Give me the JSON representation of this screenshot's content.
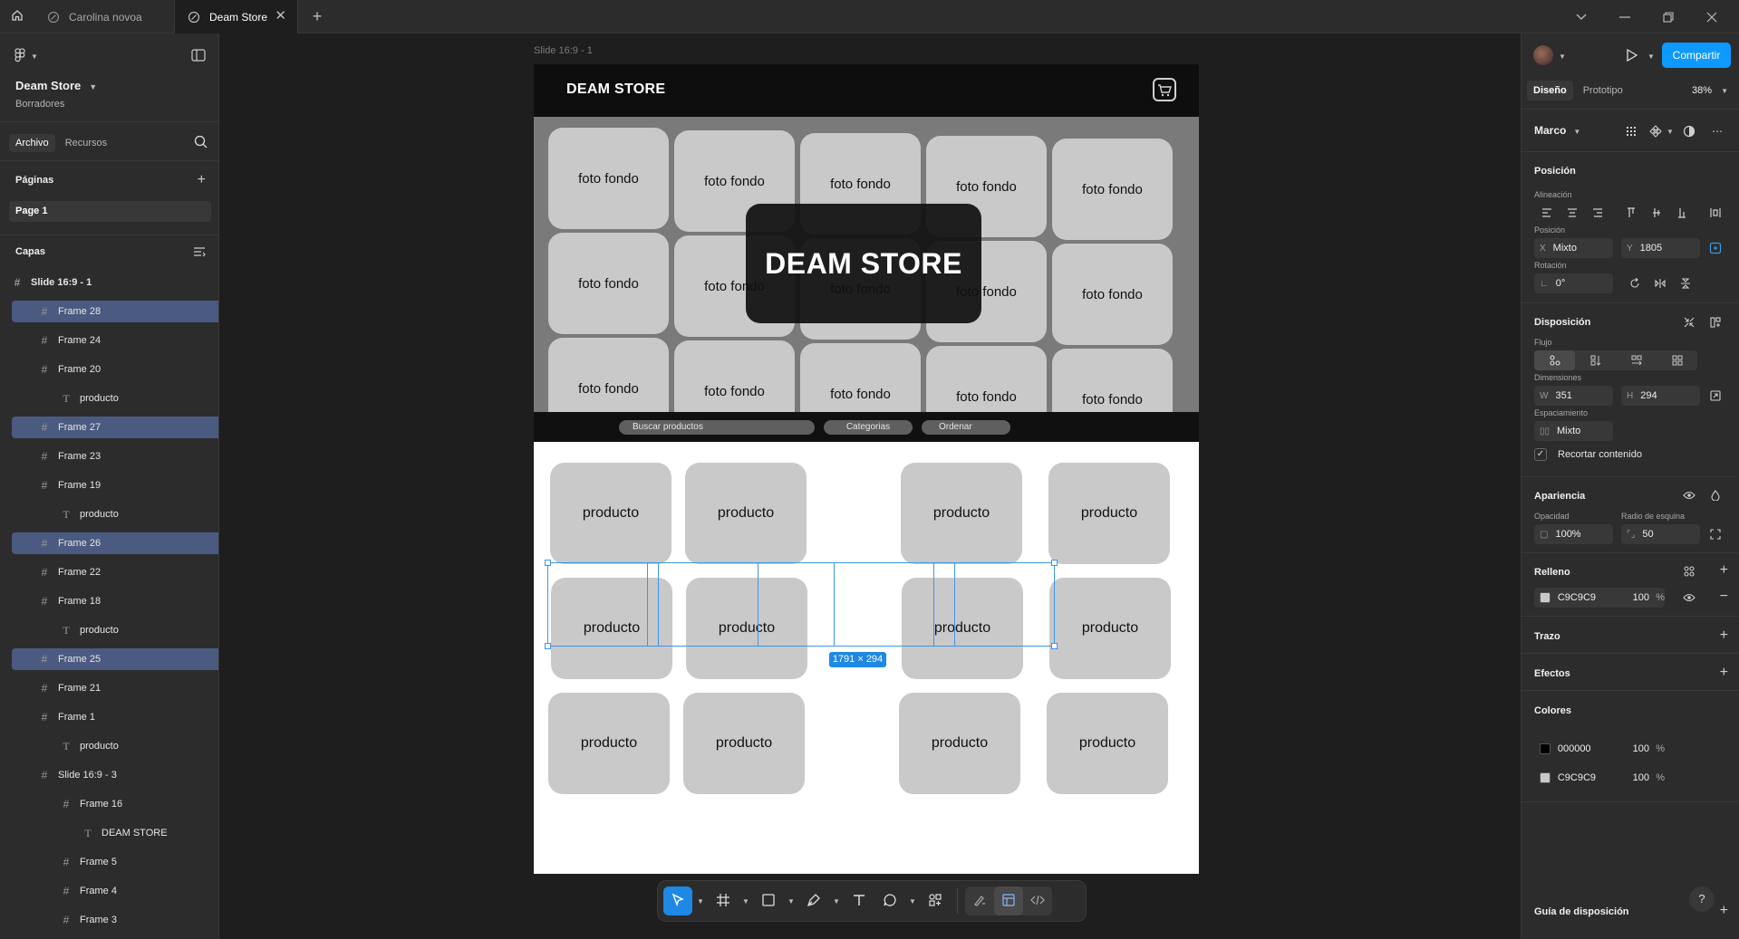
{
  "tabs": [
    {
      "label": "Carolina novoa"
    },
    {
      "label": "Deam Store"
    }
  ],
  "file": {
    "name": "Deam Store",
    "location": "Borradores"
  },
  "left_tabs": {
    "file": "Archivo",
    "resources": "Recursos"
  },
  "pages": {
    "title": "Páginas",
    "items": [
      "Page 1"
    ]
  },
  "layers": {
    "title": "Capas",
    "root": "Slide 16:9 - 1",
    "items": [
      {
        "label": "Frame 28",
        "selected": true,
        "type": "frame"
      },
      {
        "label": "Frame 24",
        "selected": false,
        "type": "frame"
      },
      {
        "label": "Frame 20",
        "selected": false,
        "type": "frame"
      },
      {
        "label": "producto",
        "selected": false,
        "type": "text"
      },
      {
        "label": "Frame 27",
        "selected": true,
        "type": "frame"
      },
      {
        "label": "Frame 23",
        "selected": false,
        "type": "frame"
      },
      {
        "label": "Frame 19",
        "selected": false,
        "type": "frame"
      },
      {
        "label": "producto",
        "selected": false,
        "type": "text"
      },
      {
        "label": "Frame 26",
        "selected": true,
        "type": "frame"
      },
      {
        "label": "Frame 22",
        "selected": false,
        "type": "frame"
      },
      {
        "label": "Frame 18",
        "selected": false,
        "type": "frame"
      },
      {
        "label": "producto",
        "selected": false,
        "type": "text"
      },
      {
        "label": "Frame 25",
        "selected": true,
        "type": "frame"
      },
      {
        "label": "Frame 21",
        "selected": false,
        "type": "frame"
      },
      {
        "label": "Frame 1",
        "selected": false,
        "type": "frame"
      },
      {
        "label": "producto",
        "selected": false,
        "type": "text"
      },
      {
        "label": "Slide 16:9 - 3",
        "selected": false,
        "type": "frame"
      },
      {
        "label": "Frame 16",
        "selected": false,
        "type": "frame"
      },
      {
        "label": "DEAM STORE",
        "selected": false,
        "type": "text"
      },
      {
        "label": "Frame 5",
        "selected": false,
        "type": "frame"
      },
      {
        "label": "Frame 4",
        "selected": false,
        "type": "frame"
      },
      {
        "label": "Frame 3",
        "selected": false,
        "type": "frame"
      }
    ]
  },
  "canvas": {
    "frame_label": "Slide 16:9 - 1",
    "selection_size": "1791 × 294",
    "slide": {
      "brand": "DEAM STORE",
      "hero_title": "DEAM STORE",
      "tile_label": "foto fondo",
      "search": "Buscar productos",
      "categories": "Categorias",
      "sort": "Ordenar",
      "product_label": "producto"
    }
  },
  "right": {
    "share": "Compartir",
    "tab_design": "Diseño",
    "tab_prototype": "Prototipo",
    "zoom": "38%",
    "frame_type": "Marco",
    "position_title": "Posición",
    "alignment_label": "Alineación",
    "position_label": "Posición",
    "x_label": "X",
    "x_value": "Mixto",
    "y_label": "Y",
    "y_value": "1805",
    "rotation_label": "Rotación",
    "rotation_value": "0°",
    "layout_title": "Disposición",
    "flow_label": "Flujo",
    "dimensions_label": "Dimensiones",
    "w_label": "W",
    "w_value": "351",
    "h_label": "H",
    "h_value": "294",
    "spacing_label": "Espaciamiento",
    "spacing_value": "Mixto",
    "clip_label": "Recortar contenido",
    "appearance_title": "Apariencia",
    "opacity_label": "Opacidad",
    "opacity_value": "100%",
    "radius_label": "Radio de esquina",
    "radius_value": "50",
    "fill_title": "Relleno",
    "fill_hex": "C9C9C9",
    "fill_opacity": "100",
    "percent": "%",
    "stroke_title": "Trazo",
    "effects_title": "Efectos",
    "colors_title": "Colores",
    "color1_hex": "000000",
    "color1_opacity": "100",
    "color2_hex": "C9C9C9",
    "color2_opacity": "100",
    "layout_guide_title": "Guía de disposición"
  },
  "colors": {
    "accent": "#0d99ff",
    "selection": "#4b5a80",
    "tile": "#c9c9c9"
  }
}
